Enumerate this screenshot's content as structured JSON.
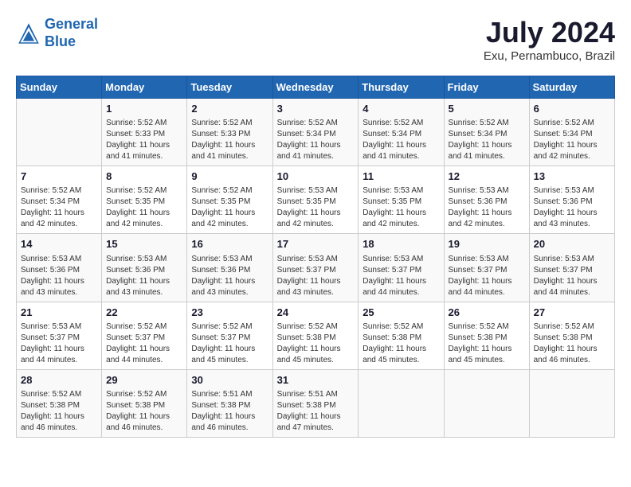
{
  "header": {
    "logo_line1": "General",
    "logo_line2": "Blue",
    "month_title": "July 2024",
    "location": "Exu, Pernambuco, Brazil"
  },
  "weekdays": [
    "Sunday",
    "Monday",
    "Tuesday",
    "Wednesday",
    "Thursday",
    "Friday",
    "Saturday"
  ],
  "weeks": [
    [
      {
        "day": "",
        "info": ""
      },
      {
        "day": "1",
        "info": "Sunrise: 5:52 AM\nSunset: 5:33 PM\nDaylight: 11 hours\nand 41 minutes."
      },
      {
        "day": "2",
        "info": "Sunrise: 5:52 AM\nSunset: 5:33 PM\nDaylight: 11 hours\nand 41 minutes."
      },
      {
        "day": "3",
        "info": "Sunrise: 5:52 AM\nSunset: 5:34 PM\nDaylight: 11 hours\nand 41 minutes."
      },
      {
        "day": "4",
        "info": "Sunrise: 5:52 AM\nSunset: 5:34 PM\nDaylight: 11 hours\nand 41 minutes."
      },
      {
        "day": "5",
        "info": "Sunrise: 5:52 AM\nSunset: 5:34 PM\nDaylight: 11 hours\nand 41 minutes."
      },
      {
        "day": "6",
        "info": "Sunrise: 5:52 AM\nSunset: 5:34 PM\nDaylight: 11 hours\nand 42 minutes."
      }
    ],
    [
      {
        "day": "7",
        "info": "Sunrise: 5:52 AM\nSunset: 5:34 PM\nDaylight: 11 hours\nand 42 minutes."
      },
      {
        "day": "8",
        "info": "Sunrise: 5:52 AM\nSunset: 5:35 PM\nDaylight: 11 hours\nand 42 minutes."
      },
      {
        "day": "9",
        "info": "Sunrise: 5:52 AM\nSunset: 5:35 PM\nDaylight: 11 hours\nand 42 minutes."
      },
      {
        "day": "10",
        "info": "Sunrise: 5:53 AM\nSunset: 5:35 PM\nDaylight: 11 hours\nand 42 minutes."
      },
      {
        "day": "11",
        "info": "Sunrise: 5:53 AM\nSunset: 5:35 PM\nDaylight: 11 hours\nand 42 minutes."
      },
      {
        "day": "12",
        "info": "Sunrise: 5:53 AM\nSunset: 5:36 PM\nDaylight: 11 hours\nand 42 minutes."
      },
      {
        "day": "13",
        "info": "Sunrise: 5:53 AM\nSunset: 5:36 PM\nDaylight: 11 hours\nand 43 minutes."
      }
    ],
    [
      {
        "day": "14",
        "info": "Sunrise: 5:53 AM\nSunset: 5:36 PM\nDaylight: 11 hours\nand 43 minutes."
      },
      {
        "day": "15",
        "info": "Sunrise: 5:53 AM\nSunset: 5:36 PM\nDaylight: 11 hours\nand 43 minutes."
      },
      {
        "day": "16",
        "info": "Sunrise: 5:53 AM\nSunset: 5:36 PM\nDaylight: 11 hours\nand 43 minutes."
      },
      {
        "day": "17",
        "info": "Sunrise: 5:53 AM\nSunset: 5:37 PM\nDaylight: 11 hours\nand 43 minutes."
      },
      {
        "day": "18",
        "info": "Sunrise: 5:53 AM\nSunset: 5:37 PM\nDaylight: 11 hours\nand 44 minutes."
      },
      {
        "day": "19",
        "info": "Sunrise: 5:53 AM\nSunset: 5:37 PM\nDaylight: 11 hours\nand 44 minutes."
      },
      {
        "day": "20",
        "info": "Sunrise: 5:53 AM\nSunset: 5:37 PM\nDaylight: 11 hours\nand 44 minutes."
      }
    ],
    [
      {
        "day": "21",
        "info": "Sunrise: 5:53 AM\nSunset: 5:37 PM\nDaylight: 11 hours\nand 44 minutes."
      },
      {
        "day": "22",
        "info": "Sunrise: 5:52 AM\nSunset: 5:37 PM\nDaylight: 11 hours\nand 44 minutes."
      },
      {
        "day": "23",
        "info": "Sunrise: 5:52 AM\nSunset: 5:37 PM\nDaylight: 11 hours\nand 45 minutes."
      },
      {
        "day": "24",
        "info": "Sunrise: 5:52 AM\nSunset: 5:38 PM\nDaylight: 11 hours\nand 45 minutes."
      },
      {
        "day": "25",
        "info": "Sunrise: 5:52 AM\nSunset: 5:38 PM\nDaylight: 11 hours\nand 45 minutes."
      },
      {
        "day": "26",
        "info": "Sunrise: 5:52 AM\nSunset: 5:38 PM\nDaylight: 11 hours\nand 45 minutes."
      },
      {
        "day": "27",
        "info": "Sunrise: 5:52 AM\nSunset: 5:38 PM\nDaylight: 11 hours\nand 46 minutes."
      }
    ],
    [
      {
        "day": "28",
        "info": "Sunrise: 5:52 AM\nSunset: 5:38 PM\nDaylight: 11 hours\nand 46 minutes."
      },
      {
        "day": "29",
        "info": "Sunrise: 5:52 AM\nSunset: 5:38 PM\nDaylight: 11 hours\nand 46 minutes."
      },
      {
        "day": "30",
        "info": "Sunrise: 5:51 AM\nSunset: 5:38 PM\nDaylight: 11 hours\nand 46 minutes."
      },
      {
        "day": "31",
        "info": "Sunrise: 5:51 AM\nSunset: 5:38 PM\nDaylight: 11 hours\nand 47 minutes."
      },
      {
        "day": "",
        "info": ""
      },
      {
        "day": "",
        "info": ""
      },
      {
        "day": "",
        "info": ""
      }
    ]
  ]
}
